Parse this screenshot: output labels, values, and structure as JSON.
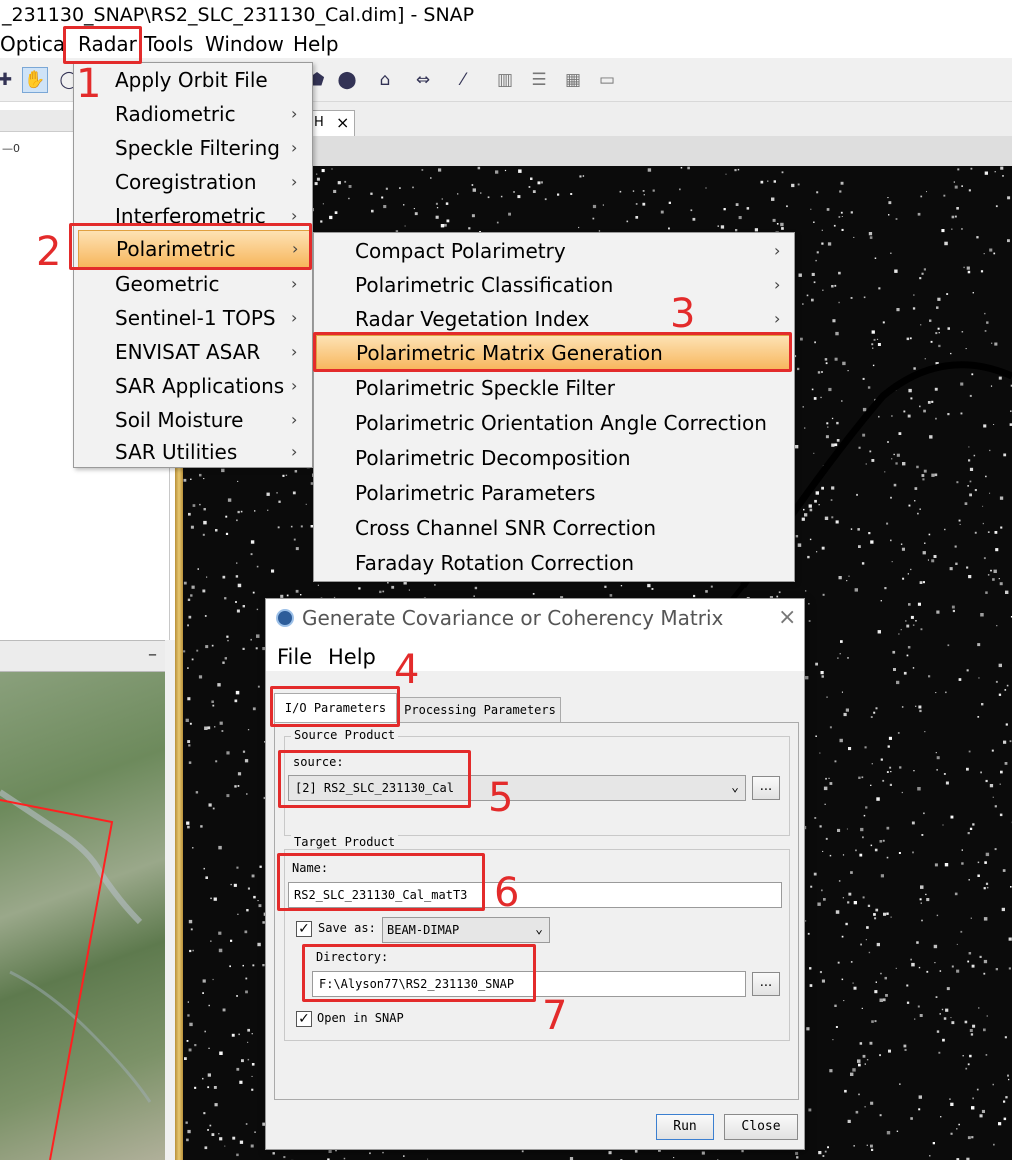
{
  "window": {
    "title": "_231130_SNAP\\RS2_SLC_231130_Cal.dim] - SNAP"
  },
  "menubar": {
    "items": [
      "Optica",
      "Radar",
      "Tools",
      "Window",
      "Help"
    ]
  },
  "left_panel": {
    "tiny_label": "—0"
  },
  "view_tab": {
    "label": "H",
    "close": "×"
  },
  "radar_menu": {
    "items": [
      {
        "label": "Apply Orbit File",
        "submenu": false
      },
      {
        "label": "Radiometric",
        "submenu": true
      },
      {
        "label": "Speckle Filtering",
        "submenu": true
      },
      {
        "label": "Coregistration",
        "submenu": true
      },
      {
        "label": "Interferometric",
        "submenu": true
      },
      {
        "label": "Polarimetric",
        "submenu": true
      },
      {
        "label": "Geometric",
        "submenu": true
      },
      {
        "label": "Sentinel-1 TOPS",
        "submenu": true
      },
      {
        "label": "ENVISAT ASAR",
        "submenu": true
      },
      {
        "label": "SAR Applications",
        "submenu": true
      },
      {
        "label": "Soil Moisture",
        "submenu": true
      },
      {
        "label": "SAR Utilities",
        "submenu": true
      }
    ]
  },
  "polarimetric_menu": {
    "items": [
      {
        "label": "Compact Polarimetry",
        "submenu": true
      },
      {
        "label": "Polarimetric Classification",
        "submenu": true
      },
      {
        "label": "Radar Vegetation Index",
        "submenu": true
      },
      {
        "label": "Polarimetric Matrix Generation",
        "submenu": false
      },
      {
        "label": "Polarimetric Speckle Filter",
        "submenu": false
      },
      {
        "label": "Polarimetric Orientation Angle Correction",
        "submenu": false
      },
      {
        "label": "Polarimetric Decomposition",
        "submenu": false
      },
      {
        "label": "Polarimetric Parameters",
        "submenu": false
      },
      {
        "label": "Cross Channel SNR Correction",
        "submenu": false
      },
      {
        "label": "Faraday Rotation Correction",
        "submenu": false
      }
    ]
  },
  "dialog": {
    "title": "Generate Covariance or Coherency Matrix",
    "close": "×",
    "menu": [
      "File",
      "Help"
    ],
    "tabs": [
      "I/O Parameters",
      "Processing Parameters"
    ],
    "source_group": "Source Product",
    "source_label": "source:",
    "source_value": "[2] RS2_SLC_231130_Cal",
    "browse": "...",
    "target_group": "Target Product",
    "name_label": "Name:",
    "name_value": "RS2_SLC_231130_Cal_matT3",
    "save_as_label": "Save as:",
    "save_as_checked": true,
    "save_as_format": "BEAM-DIMAP",
    "directory_label": "Directory:",
    "directory_value": "F:\\Alyson77\\RS2_231130_SNAP",
    "open_in_snap_label": "Open in SNAP",
    "open_in_snap_checked": true,
    "run": "Run",
    "close_button": "Close"
  },
  "annotations": [
    "1",
    "2",
    "3",
    "4",
    "5",
    "6",
    "7"
  ],
  "colors": {
    "annotation_red": "#e32b2b",
    "menu_highlight": "#f7b65c",
    "sar_background": "#0b0b0b"
  },
  "icons": [
    "hand-pan-icon",
    "zoom-icon",
    "ellipse-tool-icon",
    "polygon-tool-icon",
    "pin-tool-icon",
    "ruler-icon",
    "magic-wand-icon",
    "tile-even-icon",
    "tile-horizontal-icon",
    "tile-grid-icon",
    "folder-icon"
  ]
}
